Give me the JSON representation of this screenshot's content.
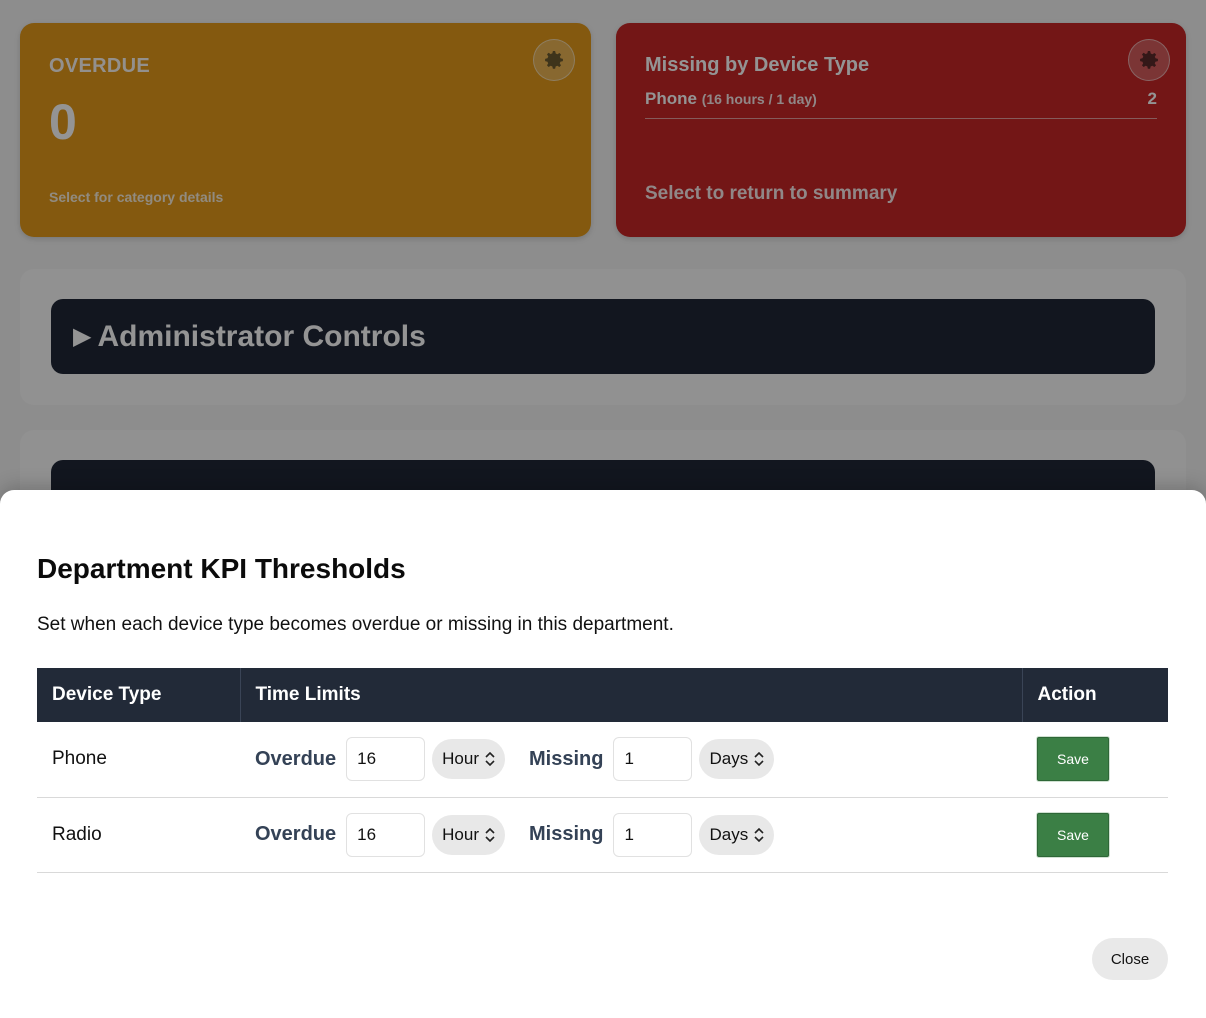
{
  "dashboard": {
    "overdue_card": {
      "label": "OVERDUE",
      "count": "0",
      "hint": "Select for category details",
      "color": "#e39a1a",
      "icon": "gear-icon"
    },
    "missing_card": {
      "title": "Missing by Device Type",
      "row": {
        "name": "Phone",
        "detail": "(16 hours / 1 day)",
        "count": "2"
      },
      "hint": "Select to return to summary",
      "color": "#c62626",
      "icon": "gear-icon"
    },
    "admin_controls": {
      "label": "Administrator Controls",
      "icon": "triangle-right-icon"
    }
  },
  "modal": {
    "title": "Department KPI Thresholds",
    "description": "Set when each device type becomes overdue or missing in this department.",
    "columns": [
      "Device Type",
      "Time Limits",
      "Action"
    ],
    "overdue_label": "Overdue",
    "missing_label": "Missing",
    "rows": [
      {
        "device": "Phone",
        "overdue_value": "16",
        "overdue_unit": "Hour",
        "missing_value": "1",
        "missing_unit": "Days",
        "action": "Save"
      },
      {
        "device": "Radio",
        "overdue_value": "16",
        "overdue_unit": "Hour",
        "missing_value": "1",
        "missing_unit": "Days",
        "action": "Save"
      }
    ],
    "close_label": "Close",
    "save_color": "#3b7f45",
    "header_color": "#222a38"
  }
}
